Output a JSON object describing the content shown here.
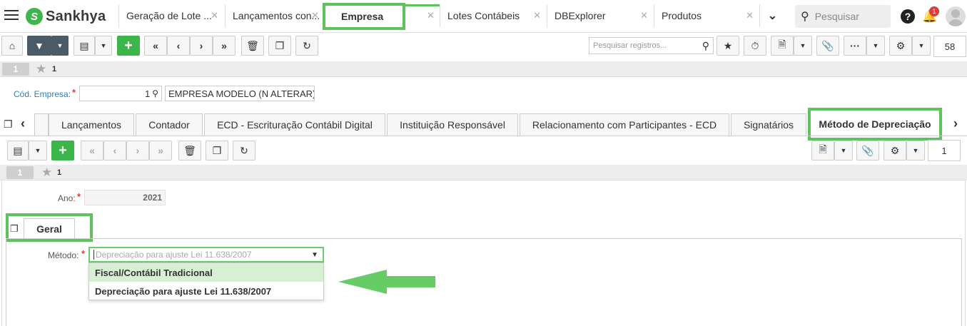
{
  "app": {
    "brand": "Sankhya"
  },
  "top_tabs": [
    {
      "label": "Geração de Lote ..."
    },
    {
      "label": "Lançamentos con..."
    },
    {
      "label": "Empresa"
    },
    {
      "label": "Lotes Contábeis"
    },
    {
      "label": "DBExplorer"
    },
    {
      "label": "Produtos"
    }
  ],
  "top_search": {
    "placeholder": "Pesquisar"
  },
  "notifications": {
    "count": "1"
  },
  "main_toolbar": {
    "search_placeholder": "Pesquisar registros...",
    "record_count": "58"
  },
  "main_record": {
    "index": "1",
    "fav_count": "1"
  },
  "company": {
    "code_label": "Cód. Empresa:",
    "code_value": "1",
    "name_value": "EMPRESA MODELO (N ALTERAR)"
  },
  "inner_tabs": [
    {
      "label": "Lançamentos"
    },
    {
      "label": "Contador"
    },
    {
      "label": "ECD - Escrituração Contábil Digital"
    },
    {
      "label": "Instituição Responsável"
    },
    {
      "label": "Relacionamento com Participantes - ECD"
    },
    {
      "label": "Signatários"
    },
    {
      "label": "Método de Depreciação"
    }
  ],
  "sub_toolbar": {
    "record_count": "1"
  },
  "sub_record": {
    "index": "1",
    "fav_count": "1"
  },
  "year": {
    "label": "Ano:",
    "value": "2021"
  },
  "section_tab": {
    "label": "Geral"
  },
  "method": {
    "label": "Método:",
    "value": "Depreciação para ajuste  Lei 11.638/2007",
    "options": [
      {
        "label": "Fiscal/Contábil Tradicional"
      },
      {
        "label": "Depreciação para ajuste Lei 11.638/2007"
      }
    ]
  },
  "colors": {
    "accent_green": "#5ec35e",
    "brand_green": "#3cb54b",
    "arrow_green": "#66cc66"
  }
}
